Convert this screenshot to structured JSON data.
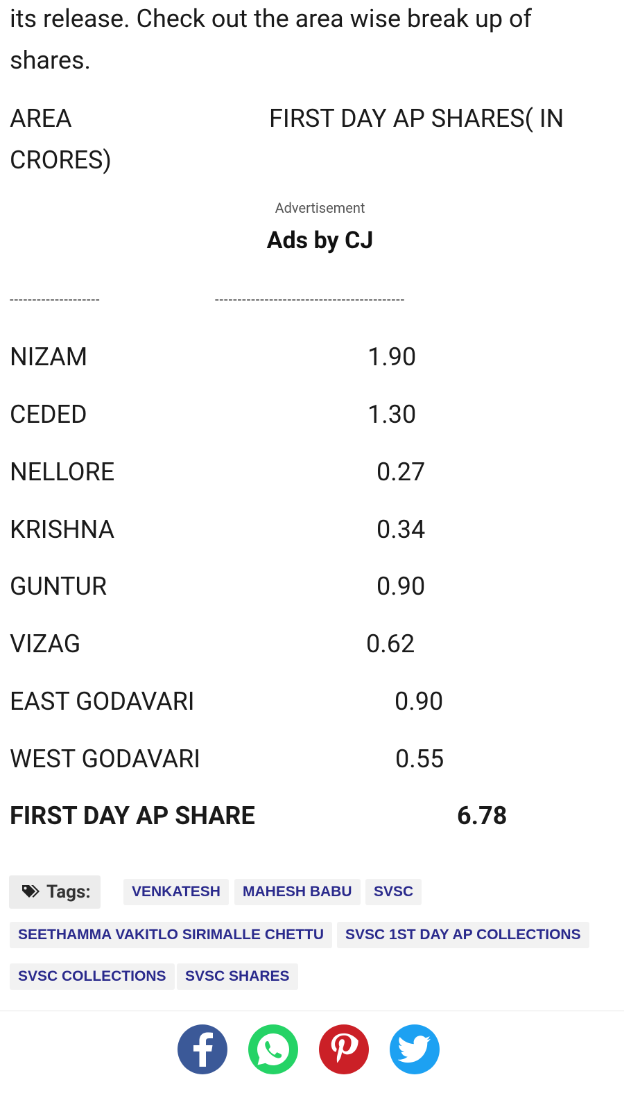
{
  "intro": {
    "line1": "its release. Check out the area wise break up of",
    "line2": "shares."
  },
  "table_header": {
    "area": "AREA",
    "shares_line1": "FIRST DAY AP SHARES( IN",
    "shares_line2": "CRORES)"
  },
  "ad": {
    "label": "Advertisement",
    "title": "Ads by CJ"
  },
  "dashes": {
    "left": "--------------------",
    "right": "------------------------------------------"
  },
  "rows": [
    {
      "area": "NIZAM",
      "value": "1.90"
    },
    {
      "area": "CEDED",
      "value": "1.30"
    },
    {
      "area": "NELLORE",
      "value": "0.27"
    },
    {
      "area": "KRISHNA",
      "value": "0.34"
    },
    {
      "area": "GUNTUR",
      "value": "0.90"
    },
    {
      "area": "VIZAG",
      "value": "0.62"
    },
    {
      "area": "EAST GODAVARI",
      "value": "0.90"
    },
    {
      "area": "WEST GODAVARI",
      "value": "0.55"
    }
  ],
  "total": {
    "label": "FIRST DAY AP SHARE",
    "value": "6.78"
  },
  "tags": {
    "label": "Tags:",
    "items": [
      "VENKATESH",
      "MAHESH BABU",
      "SVSC",
      "SEETHAMMA VAKITLO SIRIMALLE CHETTU",
      "SVSC 1ST DAY AP COLLECTIONS",
      "SVSC COLLECTIONS",
      "SVSC SHARES"
    ]
  },
  "share": {
    "colors": {
      "facebook": "#3b5998",
      "whatsapp": "#25d366",
      "pinterest": "#cb2027",
      "twitter": "#1da1f2"
    }
  }
}
